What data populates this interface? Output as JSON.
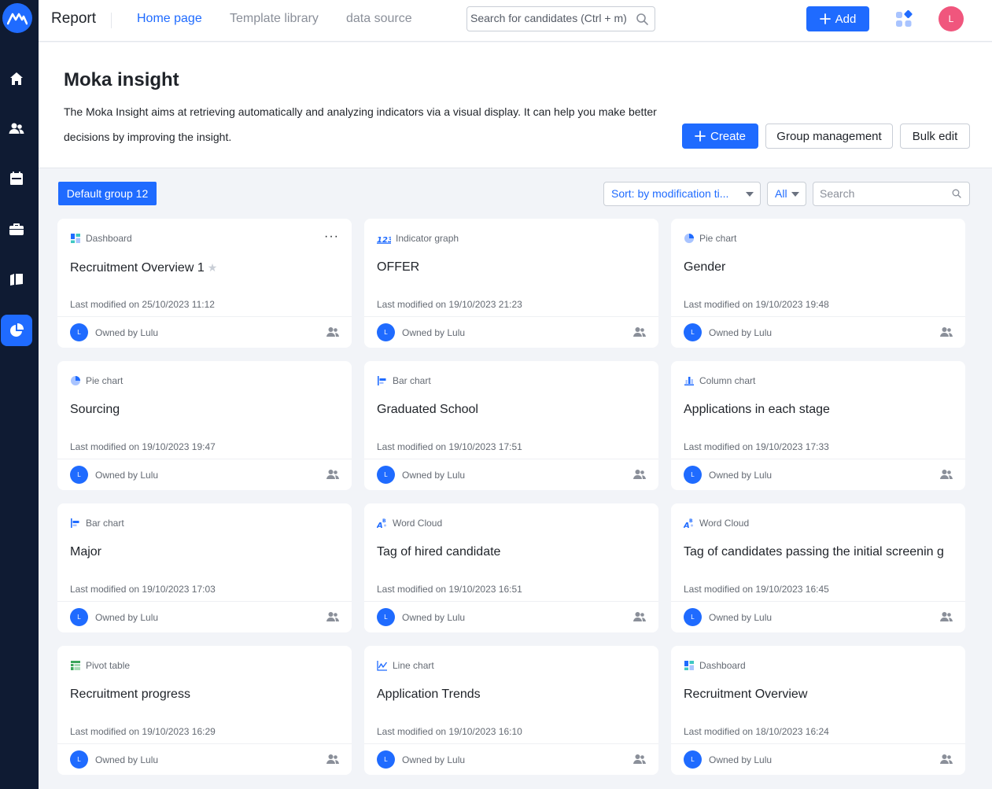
{
  "app": {
    "title": "Report"
  },
  "nav": {
    "items": [
      "Home page",
      "Template library",
      "data source"
    ],
    "active": "Home page"
  },
  "top_search": {
    "placeholder": "Search for candidates (Ctrl + m)"
  },
  "add_button": {
    "label": "Add"
  },
  "user": {
    "initial": "L",
    "color": "#f0567d"
  },
  "sidebar": {
    "icons": [
      "home-icon",
      "people-icon",
      "calendar-icon",
      "briefcase-icon",
      "book-icon",
      "pie-chart-icon"
    ],
    "active": "pie-chart-icon"
  },
  "header": {
    "title": "Moka insight",
    "description": "The Moka Insight aims at retrieving automatically and analyzing indicators via a visual display. It can help you make better decisions by improving the insight.",
    "create_label": "Create",
    "group_mgmt_label": "Group management",
    "bulk_edit_label": "Bulk edit"
  },
  "filters": {
    "group_tag": "Default group 12",
    "sort_label": "Sort: by modification ti...",
    "all_label": "All",
    "search_placeholder": "Search"
  },
  "colors": {
    "accent": "#1f6bff",
    "sidebar_bg": "#0f1b33",
    "page_bg": "#f2f4f8"
  },
  "cards": [
    {
      "type": "Dashboard",
      "title": "Recruitment Overview 1",
      "starred": true,
      "date": "Last modified on 25/10/2023 11:12",
      "owner": "Owned by Lulu",
      "owner_initial": "L"
    },
    {
      "type": "Indicator graph",
      "title": "OFFER",
      "date": "Last modified on 19/10/2023 21:23",
      "owner": "Owned by Lulu",
      "owner_initial": "L"
    },
    {
      "type": "Pie chart",
      "title": "Gender",
      "date": "Last modified on 19/10/2023 19:48",
      "owner": "Owned by Lulu",
      "owner_initial": "L"
    },
    {
      "type": "Pie chart",
      "title": "Sourcing",
      "date": "Last modified on 19/10/2023 19:47",
      "owner": "Owned by Lulu",
      "owner_initial": "L"
    },
    {
      "type": "Bar chart",
      "title": "Graduated School",
      "date": "Last modified on 19/10/2023 17:51",
      "owner": "Owned by Lulu",
      "owner_initial": "L"
    },
    {
      "type": "Column chart",
      "title": "Applications in each stage",
      "date": "Last modified on 19/10/2023 17:33",
      "owner": "Owned by Lulu",
      "owner_initial": "L"
    },
    {
      "type": "Bar chart",
      "title": "Major",
      "date": "Last modified on 19/10/2023 17:03",
      "owner": "Owned by Lulu",
      "owner_initial": "L"
    },
    {
      "type": "Word Cloud",
      "title": "Tag of hired candidate",
      "date": "Last modified on 19/10/2023 16:51",
      "owner": "Owned by Lulu",
      "owner_initial": "L"
    },
    {
      "type": "Word Cloud",
      "title": "Tag of candidates passing the initial screenin g",
      "date": "Last modified on 19/10/2023 16:45",
      "owner": "Owned by Lulu",
      "owner_initial": "L"
    },
    {
      "type": "Pivot table",
      "title": "Recruitment progress",
      "date": "Last modified on 19/10/2023 16:29",
      "owner": "Owned by Lulu",
      "owner_initial": "L"
    },
    {
      "type": "Line chart",
      "title": "Application Trends",
      "date": "Last modified on 19/10/2023 16:10",
      "owner": "Owned by Lulu",
      "owner_initial": "L"
    },
    {
      "type": "Dashboard",
      "title": "Recruitment Overview",
      "date": "Last modified on 18/10/2023 16:24",
      "owner": "Owned by Lulu",
      "owner_initial": "L"
    }
  ]
}
